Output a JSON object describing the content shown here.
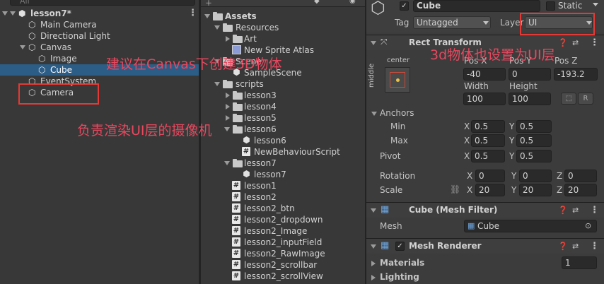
{
  "hierarchy": {
    "search_placeholder": "All",
    "scene_name": "lesson7*",
    "items": [
      {
        "label": "Main Camera"
      },
      {
        "label": "Directional Light"
      },
      {
        "label": "Canvas"
      },
      {
        "label": "Image"
      },
      {
        "label": "Cube"
      },
      {
        "label": "EventSystem"
      },
      {
        "label": "Camera"
      }
    ]
  },
  "project": {
    "root": "Assets",
    "items": [
      {
        "label": "Resources"
      },
      {
        "label": "Art"
      },
      {
        "label": "New Sprite Atlas"
      },
      {
        "label": "Scene"
      },
      {
        "label": "SampleScene"
      },
      {
        "label": "scripts"
      },
      {
        "label": "lesson3"
      },
      {
        "label": "lesson4"
      },
      {
        "label": "lesson5"
      },
      {
        "label": "lesson6"
      },
      {
        "label": "lesson6"
      },
      {
        "label": "NewBehaviourScript"
      },
      {
        "label": "lesson7"
      },
      {
        "label": "lesson7"
      },
      {
        "label": "lesson1"
      },
      {
        "label": "lesson2"
      },
      {
        "label": "lesson2_btn"
      },
      {
        "label": "lesson2_dropdown"
      },
      {
        "label": "lesson2_Image"
      },
      {
        "label": "lesson2_inputField"
      },
      {
        "label": "lesson2_RawImage"
      },
      {
        "label": "lesson2_scrollbar"
      },
      {
        "label": "lesson2_scrollView"
      }
    ]
  },
  "inspector": {
    "object_name": "Cube",
    "static_label": "Static",
    "tag_label": "Tag",
    "tag_value": "Untagged",
    "layer_label": "Layer",
    "layer_value": "UI",
    "rect_transform": {
      "title": "Rect Transform",
      "anchor_h": "center",
      "anchor_v": "middle",
      "pos_x_label": "Pos X",
      "pos_x": "-40",
      "pos_y_label": "Pos Y",
      "pos_y": "0",
      "pos_z_label": "Pos Z",
      "pos_z": "-193.2",
      "width_label": "Width",
      "width": "100",
      "height_label": "Height",
      "height": "100",
      "r_button": "R",
      "anchors_label": "Anchors",
      "min_label": "Min",
      "min_x": "0.5",
      "min_y": "0.5",
      "max_label": "Max",
      "max_x": "0.5",
      "max_y": "0.5",
      "pivot_label": "Pivot",
      "pivot_x": "0.5",
      "pivot_y": "0.5",
      "rotation_label": "Rotation",
      "rot_x": "0",
      "rot_y": "0",
      "rot_z": "0",
      "scale_label": "Scale",
      "scale_x": "20",
      "scale_y": "20",
      "scale_z": "20",
      "x": "X",
      "y": "Y",
      "z": "Z"
    },
    "mesh_filter": {
      "title": "Cube (Mesh Filter)",
      "mesh_label": "Mesh",
      "mesh_value": "Cube"
    },
    "mesh_renderer": {
      "title": "Mesh Renderer",
      "materials_label": "Materials",
      "materials_count": "1",
      "lighting_label": "Lighting"
    }
  },
  "annotations": {
    "canvas_note": "建议在Canvas下创建3D物体",
    "camera_note": "负责渲染UI层的摄像机",
    "layer_note": "3d物体也设置为UI层",
    "color": "#e8485f"
  }
}
